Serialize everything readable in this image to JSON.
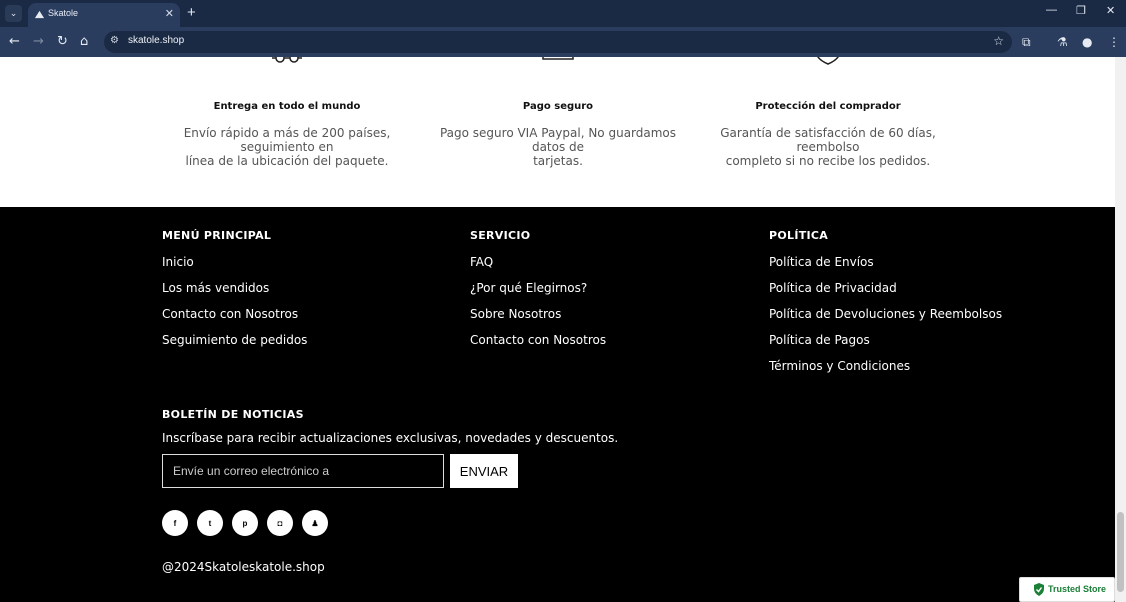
{
  "browser": {
    "tab_title": "Skatole",
    "url": "skatole.shop"
  },
  "features": [
    {
      "icon": "glasses-icon",
      "title": "Entrega en todo el mundo",
      "desc_line1": "Envío rápido a más de 200 países, seguimiento en",
      "desc_line2": "línea de la ubicación del paquete."
    },
    {
      "icon": "card-icon",
      "title": "Pago seguro",
      "desc_line1": "Pago seguro VIA Paypal, No guardamos datos de",
      "desc_line2": "tarjetas."
    },
    {
      "icon": "shield-icon",
      "title": "Protección del comprador",
      "desc_line1": "Garantía de satisfacción de 60 días, reembolso",
      "desc_line2": "completo si no recibe los pedidos."
    }
  ],
  "footer": {
    "columns": [
      {
        "title": "MENÚ PRINCIPAL",
        "links": [
          "Inicio",
          "Los más vendidos",
          "Contacto con Nosotros",
          "Seguimiento de pedidos"
        ]
      },
      {
        "title": "SERVICIO",
        "links": [
          "FAQ",
          "¿Por qué Elegirnos?",
          "Sobre Nosotros",
          "Contacto con Nosotros"
        ]
      },
      {
        "title": "POLÍTICA",
        "links": [
          "Política de Envíos",
          "Política de Privacidad",
          "Política de Devoluciones y Reembolsos",
          "Política de Pagos",
          "Términos y Condiciones"
        ]
      }
    ],
    "newsletter": {
      "title": "BOLETÍN DE NOTICIAS",
      "text": "Inscríbase para recibir actualizaciones exclusivas, novedades y descuentos.",
      "placeholder": "Envíe un correo electrónico a",
      "button": "ENVIAR"
    },
    "social": [
      {
        "icon": "facebook-icon",
        "glyph": "f"
      },
      {
        "icon": "twitter-icon",
        "glyph": "t"
      },
      {
        "icon": "pinterest-icon",
        "glyph": "p"
      },
      {
        "icon": "instagram-icon",
        "glyph": "◘"
      },
      {
        "icon": "snapchat-icon",
        "glyph": "♟"
      }
    ],
    "copyright": "@2024Skatoleskatole.shop"
  },
  "trusted_badge": "Trusted Store",
  "colors": {
    "footer_bg": "#000000",
    "chrome_bg": "#2a3d5e",
    "trusted_green": "#1a7f37"
  }
}
